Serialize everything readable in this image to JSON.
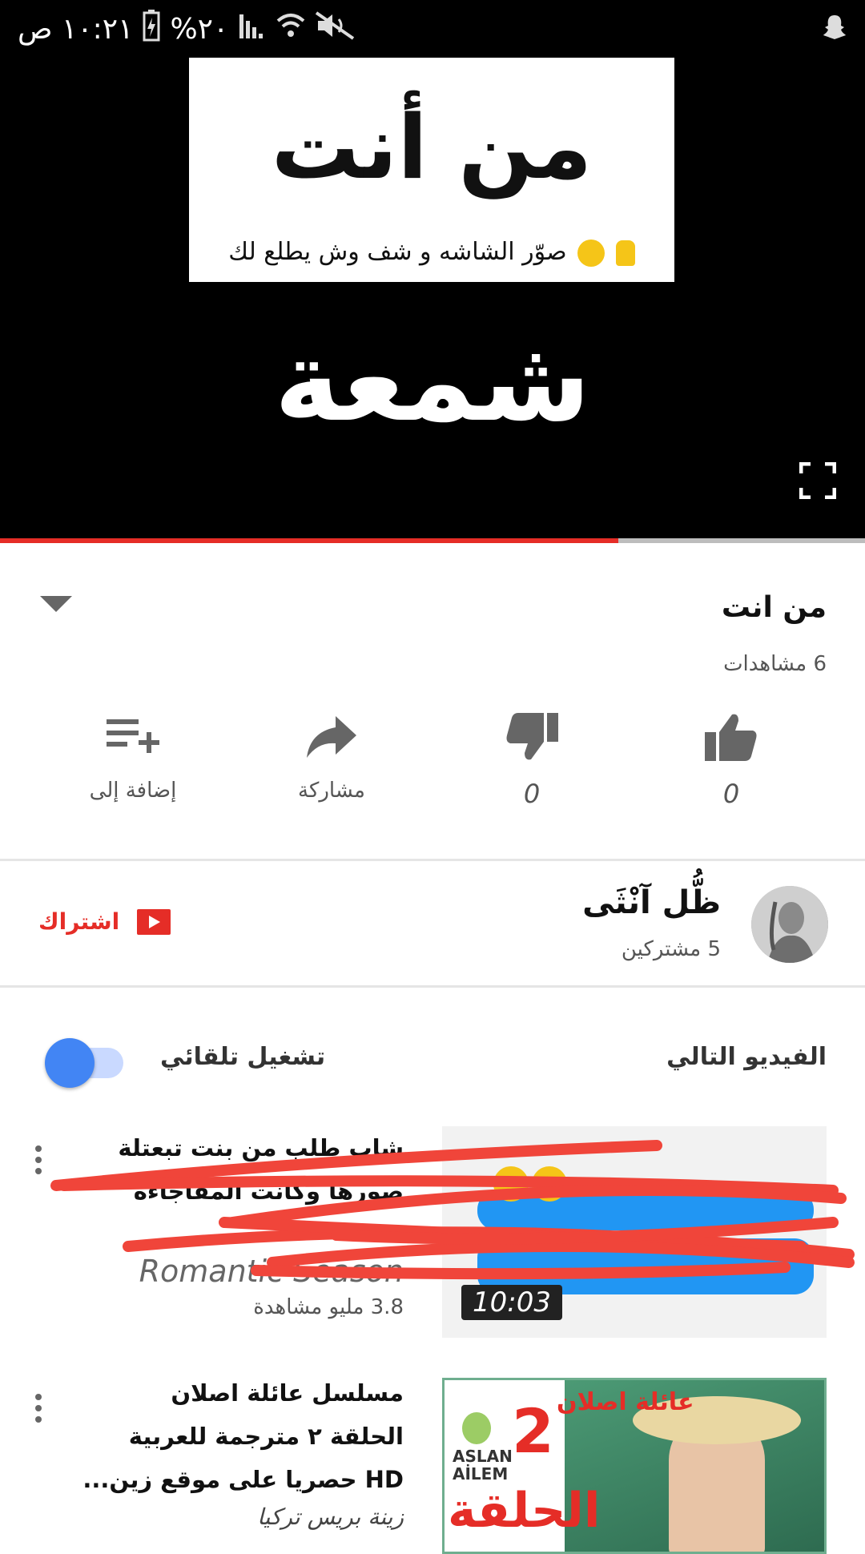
{
  "status_bar": {
    "time": "١٠:٢١ ص",
    "battery": "%٢٠",
    "icons": [
      "battery-icon",
      "signal-icon",
      "wifi-icon",
      "mute-icon",
      "snapchat-icon"
    ]
  },
  "player": {
    "card_title": "من أنت",
    "card_subtitle": "صوّر الشاشه و شف وش يطلع لك",
    "overlay_word": "شمعة",
    "progress_fraction": 0.715
  },
  "video": {
    "title": "من انت",
    "views": "6 مشاهدات",
    "actions": {
      "like_count": "0",
      "dislike_count": "0",
      "share_label": "مشاركة",
      "add_to_label": "إضافة إلى"
    }
  },
  "channel": {
    "name": "ظُّل آنْثَى",
    "subscribers": "5 مشتركين",
    "subscribe_label": "اشتراك"
  },
  "up_next": {
    "label": "الفيديو التالي",
    "autoplay_label": "تشغيل تلقائي",
    "autoplay_on": true
  },
  "items": [
    {
      "title_line1": "شاب طلب من بنت  تبعتلة",
      "title_line2": "صورها  وكانت المفاجاءه",
      "channel": "Romantic Season",
      "views": "3.8 مليو مشاهدة",
      "duration": "10:03"
    },
    {
      "title_line1": "مسلسل عائلة اصلان",
      "title_line2": "الحلقة ٢ مترجمة للعربية",
      "title_line3": "HD حصريا على موقع زين...",
      "channel": "زينة بريس تركيا",
      "thumb_heading": "عائلة اصلان",
      "thumb_number": "2",
      "thumb_episode": "الحلقة",
      "thumb_brand": "ASLAN AİLEM"
    }
  ],
  "colors": {
    "accent_red": "#e52d27",
    "toggle_blue": "#4285f4",
    "message_blue": "#2196f3",
    "scribble_red": "#f0453a"
  }
}
